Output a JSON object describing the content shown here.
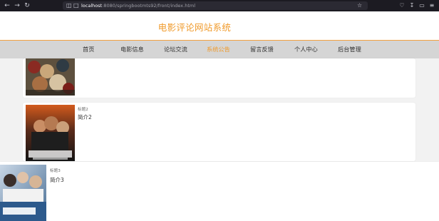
{
  "browser": {
    "url_host": "localhost",
    "url_rest": ":8080/springbootmts92/front/index.html"
  },
  "site": {
    "title": "电影评论网站系统"
  },
  "nav": {
    "items": [
      {
        "label": "首页"
      },
      {
        "label": "电影信息"
      },
      {
        "label": "论坛交流"
      },
      {
        "label": "系统公告",
        "active": true
      },
      {
        "label": "留言反馈"
      },
      {
        "label": "个人中心"
      },
      {
        "label": "后台管理"
      }
    ]
  },
  "notices": [
    {
      "title": "",
      "intro": ""
    },
    {
      "title": "标题2",
      "intro": "简介2"
    },
    {
      "title": "标题3",
      "intro": "简介3"
    }
  ],
  "colors": {
    "accent": "#f09a2a",
    "nav_bg": "#d5d5d5",
    "browser_bg": "#1c1b22"
  },
  "icons": [
    "back-arrow-icon",
    "forward-arrow-icon",
    "reload-icon",
    "shield-icon",
    "page-icon",
    "star-icon",
    "pocket-icon",
    "download-icon",
    "extensions-icon",
    "menu-icon"
  ]
}
